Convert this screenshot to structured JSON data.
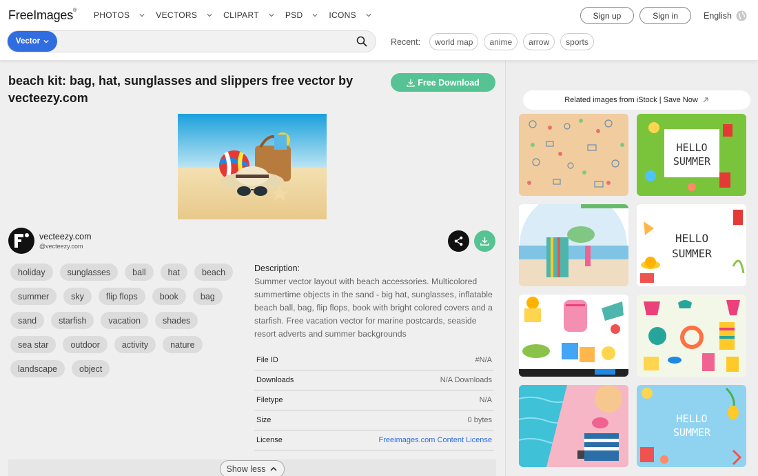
{
  "header": {
    "logo": "FreeImages",
    "logo_mark": "®",
    "nav": [
      {
        "label": "PHOTOS"
      },
      {
        "label": "VECTORS"
      },
      {
        "label": "CLIPART"
      },
      {
        "label": "PSD"
      },
      {
        "label": "ICONS"
      }
    ],
    "sign_up": "Sign up",
    "sign_in": "Sign in",
    "language": "English"
  },
  "search": {
    "type_label": "Vector",
    "value": "",
    "placeholder": ""
  },
  "recent": {
    "label": "Recent:",
    "chips": [
      "world map",
      "anime",
      "arrow",
      "sports"
    ]
  },
  "main": {
    "title": "beach kit: bag, hat, sunglasses and slippers free vector by vecteezy.com",
    "download_label": "Free Download",
    "author_name": "vecteezy.com",
    "author_handle": "@vecteezy.com",
    "tag_rows": [
      [
        "holiday",
        "sunglasses",
        "ball",
        "hat",
        "beach"
      ],
      [
        "summer",
        "sky",
        "flip flops",
        "book",
        "bag"
      ],
      [
        "sand",
        "starfish",
        "vacation",
        "shades"
      ],
      [
        "sea star",
        "outdoor",
        "activity",
        "nature"
      ],
      [
        "landscape",
        "object"
      ]
    ],
    "description_heading": "Description:",
    "description": "Summer vector layout with beach accessories. Multicolored summertime objects in the sand - big hat, sunglasses, inflatable beach ball, bag, flip flops, book with bright colored covers and a starfish. Free vacation vector for marine postcards, seaside resort adverts and summer backgrounds",
    "info": [
      {
        "key": "File ID",
        "value": "#N/A"
      },
      {
        "key": "Downloads",
        "value": "N/A Downloads"
      },
      {
        "key": "Filetype",
        "value": "N/A"
      },
      {
        "key": "Size",
        "value": "0 bytes"
      },
      {
        "key": "License",
        "value": "Freeimages.com Content License"
      }
    ],
    "show_less": "Show less"
  },
  "sidebar": {
    "related_label": "Related images from iStock | Save Now",
    "thumb_text": {
      "hello": "HELLO",
      "summer": "SUMMER"
    }
  },
  "colors": {
    "accent_blue": "#2f6de1",
    "download_green": "#55c393"
  }
}
